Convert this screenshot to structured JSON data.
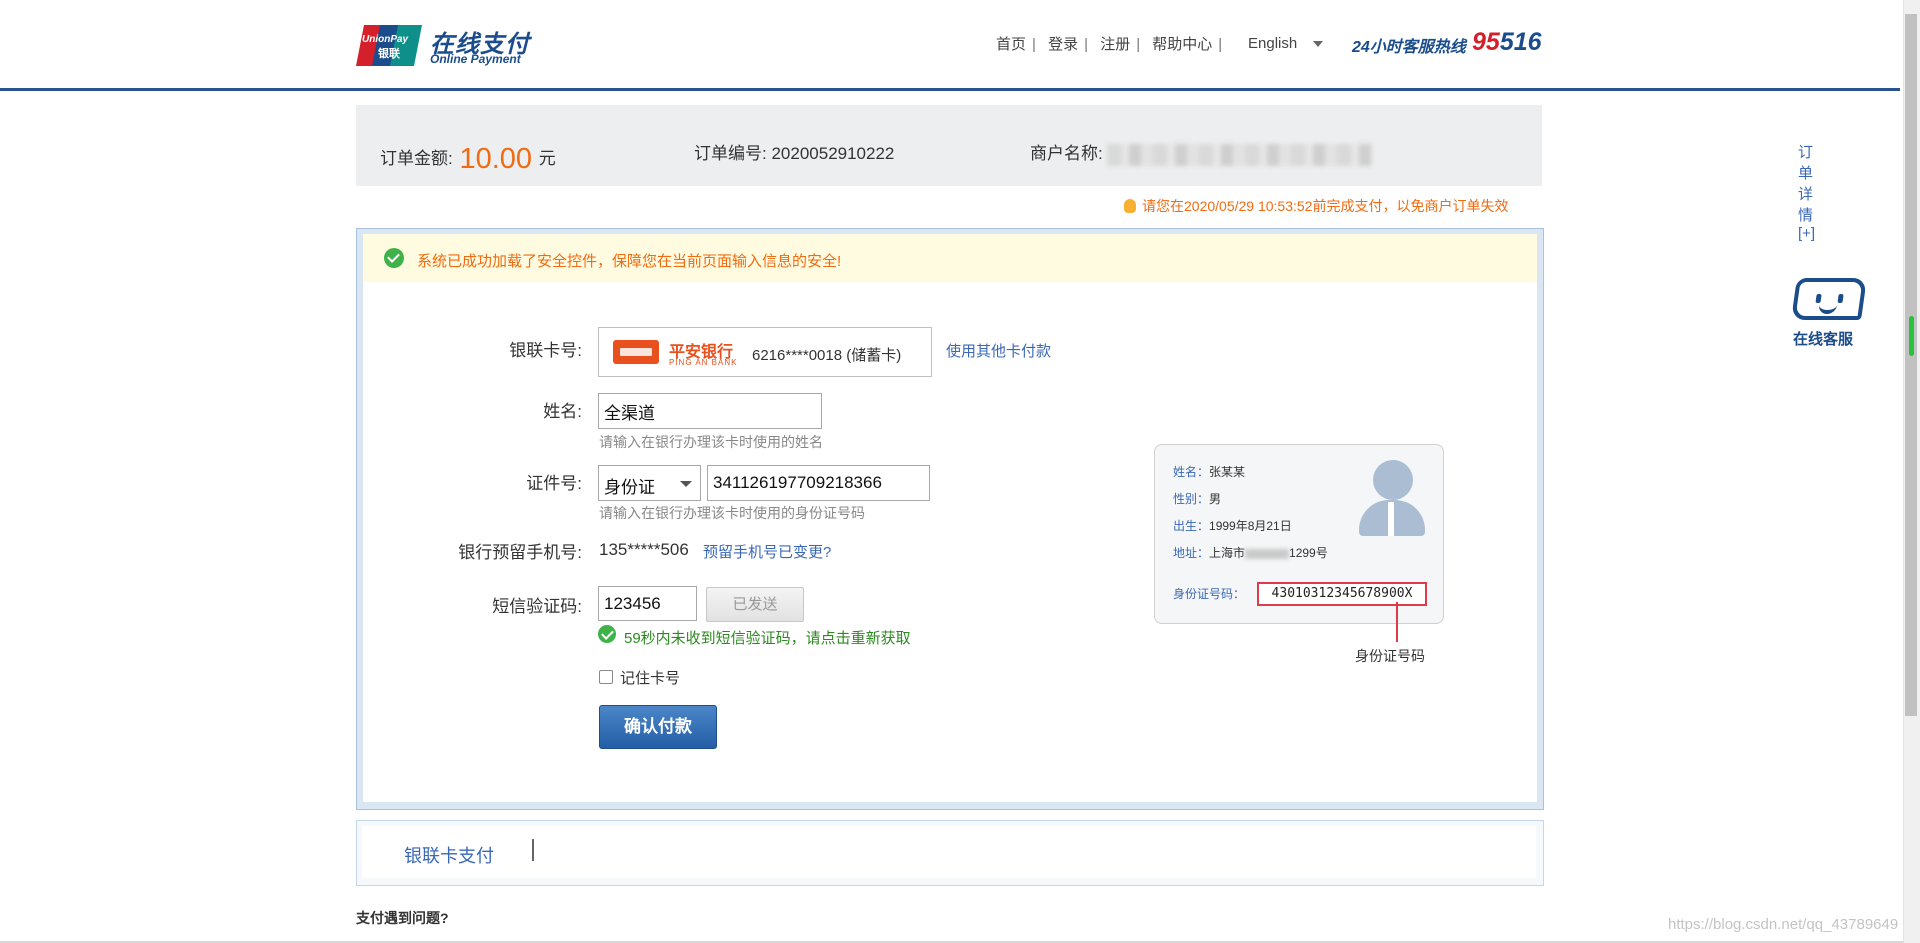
{
  "header": {
    "logo_cn": "在线支付",
    "logo_en": "Online Payment",
    "logo_badge_top": "UnionPay",
    "logo_badge_cn": "银联",
    "nav": [
      "首页",
      "登录",
      "注册",
      "帮助中心"
    ],
    "language": "English",
    "hotline_label": "24小时客服热线",
    "hotline_number_a": "95",
    "hotline_number_b": "516"
  },
  "order": {
    "amount_label": "订单金额:",
    "amount": "10.00",
    "currency": "元",
    "order_no_label": "订单编号:",
    "order_no": "2020052910222",
    "merchant_label": "商户名称:",
    "detail_link": "订单详情[+]"
  },
  "deadline_notice": "请您在2020/05/29 10:53:52前完成支付，以免商户订单失效",
  "security_notice": "系统已成功加载了安全控件，保障您在当前页面输入信息的安全!",
  "form": {
    "card_label": "银联卡号:",
    "bank_name_cn": "平安银行",
    "bank_name_en": "PING AN BANK",
    "card_number": "6216****0018 (储蓄卡)",
    "other_card_link": "使用其他卡付款",
    "name_label": "姓名:",
    "name_value": "全渠道",
    "name_hint": "请输入在银行办理该卡时使用的姓名",
    "id_label": "证件号:",
    "id_type": "身份证",
    "id_value": "341126197709218366",
    "id_hint": "请输入在银行办理该卡时使用的身份证号码",
    "phone_label": "银行预留手机号:",
    "phone_value": "135*****506",
    "phone_changed_link": "预留手机号已变更?",
    "sms_label": "短信验证码:",
    "sms_value": "123456",
    "sent_button": "已发送",
    "sms_tip": "59秒内未收到短信验证码，请点击重新获取",
    "remember_label": "记住卡号",
    "pay_button": "确认付款"
  },
  "id_card": {
    "name_key": "姓名：",
    "name_val": "张某某",
    "gender_key": "性别：",
    "gender_val": "男",
    "birth_key": "出生：",
    "birth_val": "1999年8月21日",
    "address_key": "地址：",
    "address_a": "上海市",
    "address_b": "1299号",
    "id_key": "身份证号码：",
    "id_val": "43010312345678900X",
    "caption": "身份证号码"
  },
  "tabs": {
    "unionpay_card": "银联卡支付"
  },
  "problem_label": "支付遇到问题?",
  "customer_service": "在线客服",
  "watermark": "https://blog.csdn.net/qq_43789649",
  "colors": {
    "brand_blue": "#1b4c8c",
    "accent_orange": "#f06b12",
    "link_blue": "#3a68b7",
    "success_green": "#3fb34a",
    "hotline_red": "#d4202a"
  }
}
